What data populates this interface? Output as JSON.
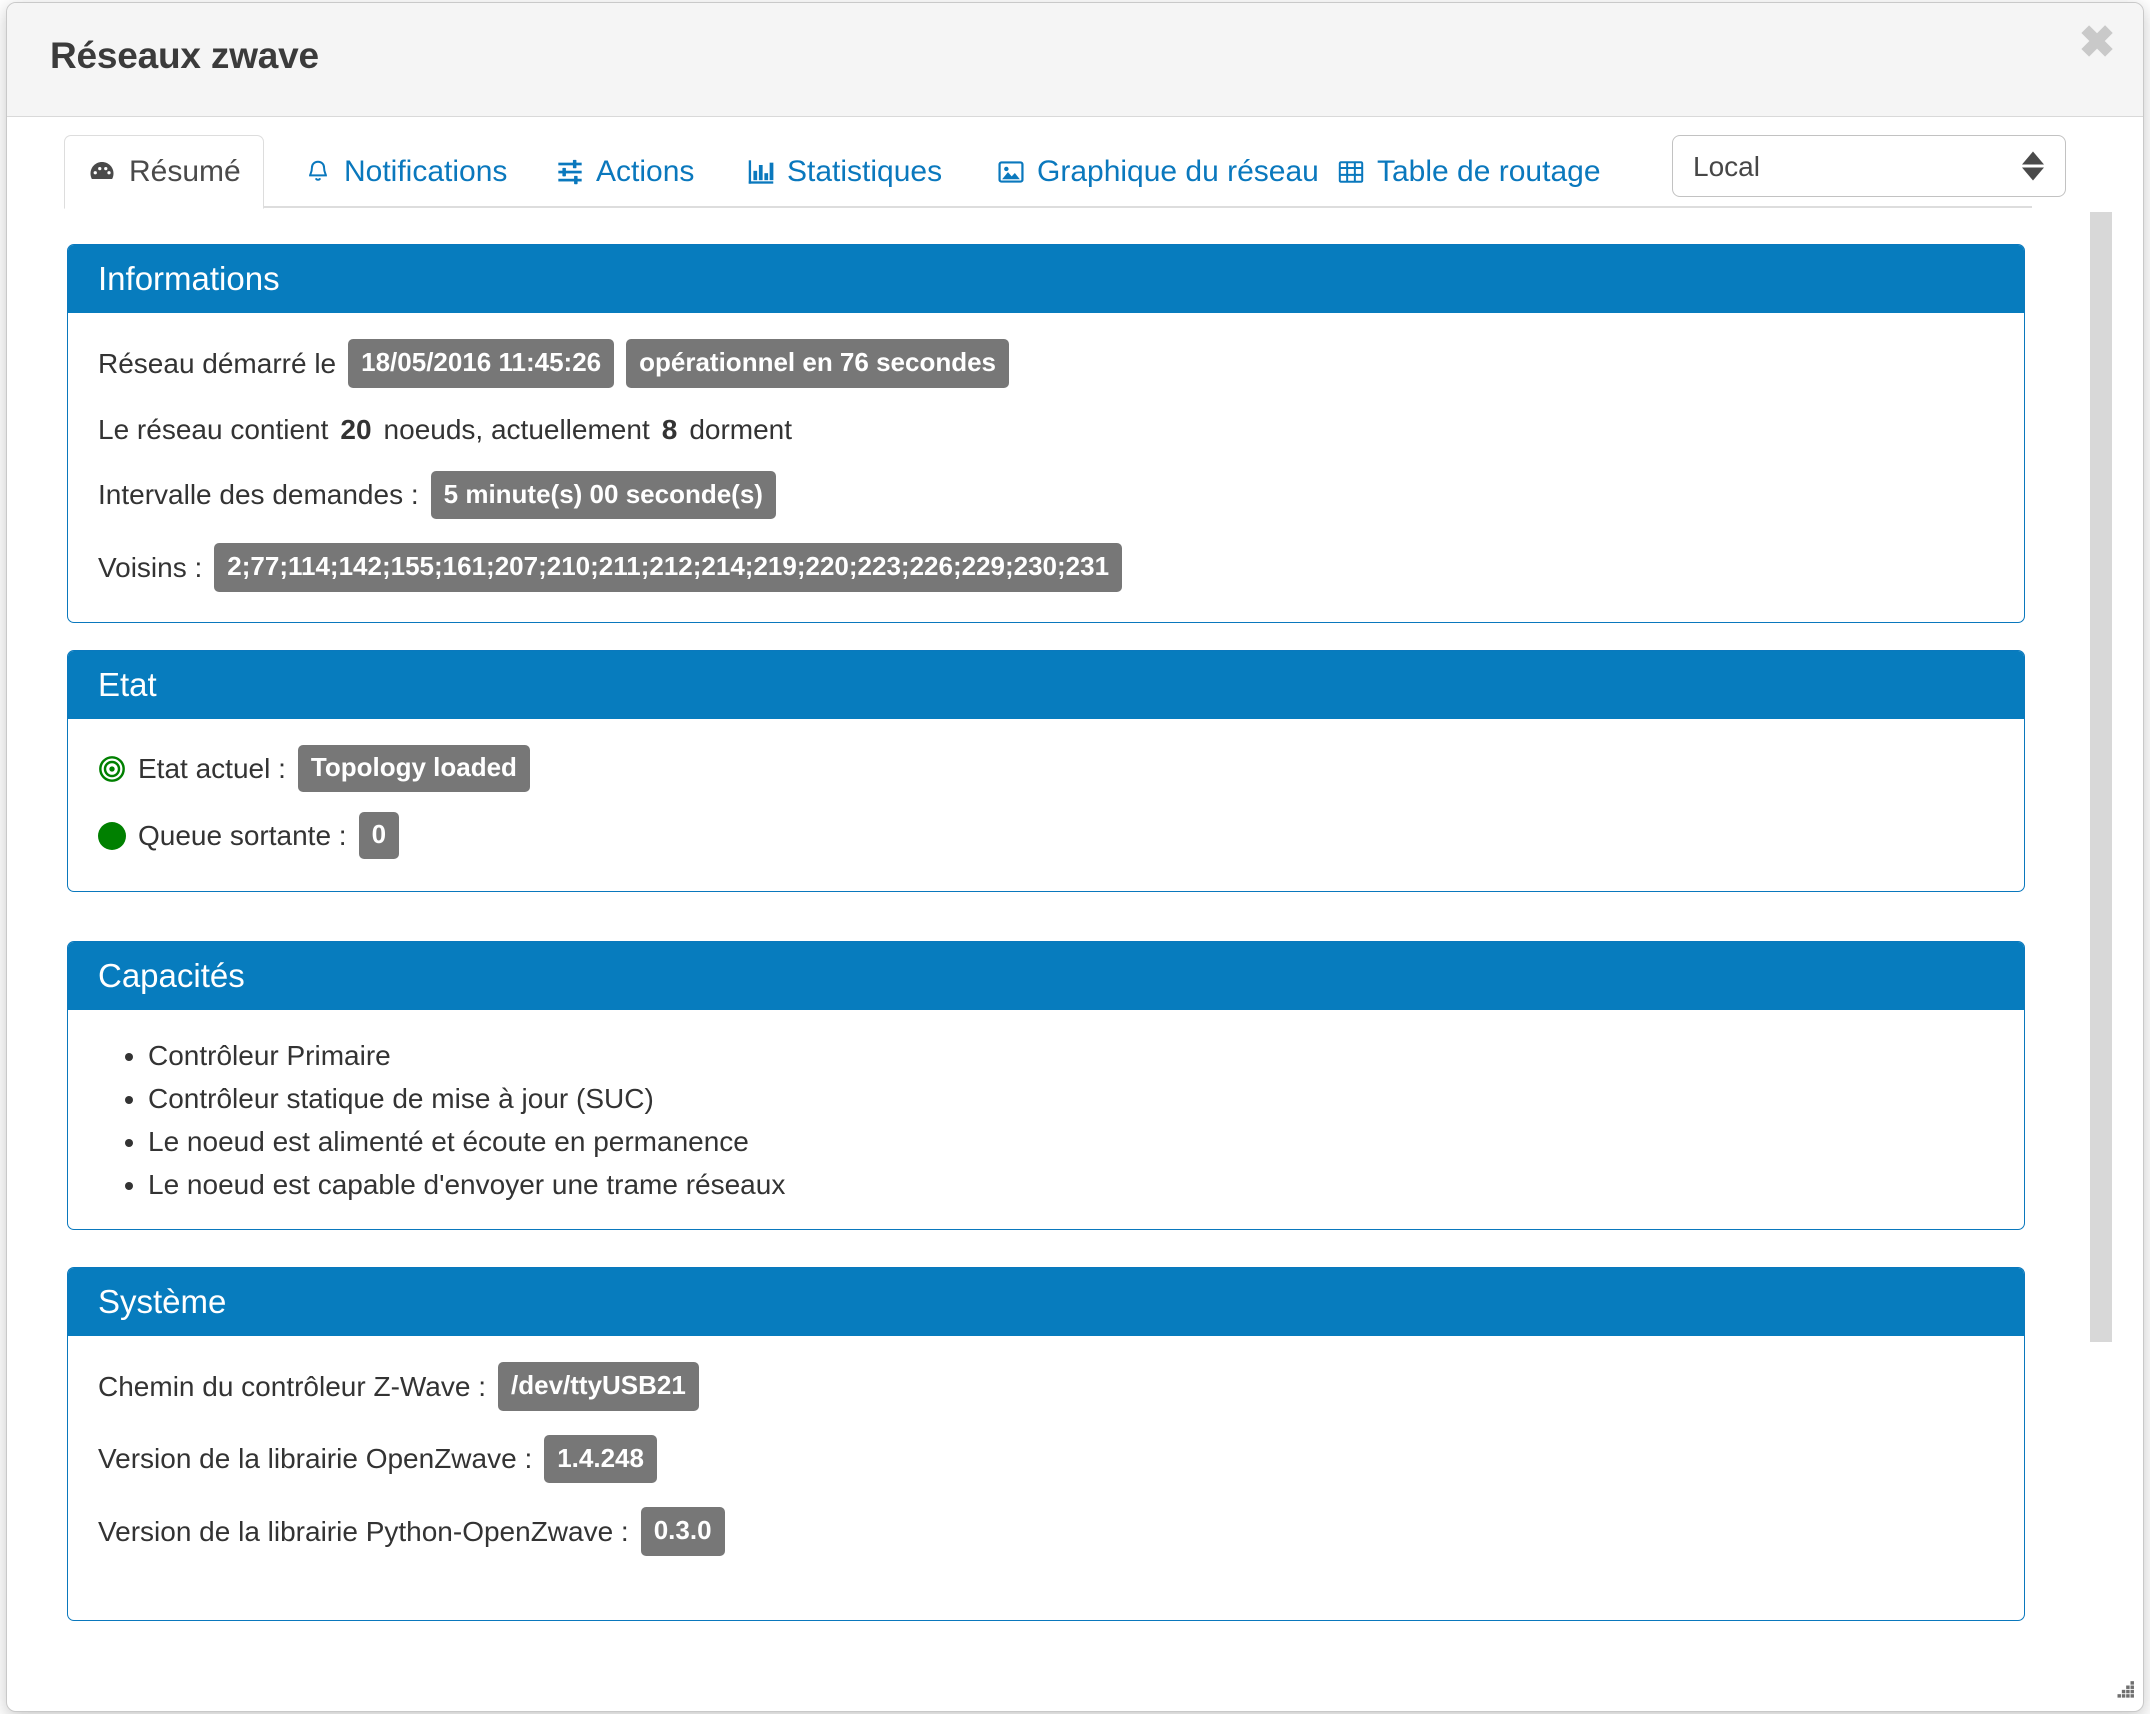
{
  "window": {
    "title": "Réseaux zwave",
    "close_label": "✖",
    "resize_handle": "resize-grip"
  },
  "tabs": [
    {
      "id": "resume",
      "label": "Résumé",
      "icon": "dashboard-icon",
      "active": true
    },
    {
      "id": "notifications",
      "label": "Notifications",
      "icon": "bell-icon",
      "active": false
    },
    {
      "id": "actions",
      "label": "Actions",
      "icon": "sliders-icon",
      "active": false
    },
    {
      "id": "statistiques",
      "label": "Statistiques",
      "icon": "bar-chart-icon",
      "active": false
    },
    {
      "id": "graphique",
      "label": "Graphique du réseau",
      "icon": "picture-icon",
      "active": false
    },
    {
      "id": "routage",
      "label": "Table de routage",
      "icon": "table-icon",
      "active": false
    }
  ],
  "network_select": {
    "value": "Local",
    "options": [
      "Local"
    ]
  },
  "panels": {
    "informations": {
      "title": "Informations",
      "started_label": "Réseau démarré le",
      "started_at": "18/05/2016 11:45:26",
      "operational_badge": "opérationnel en 76 secondes",
      "nodes_prefix": "Le réseau contient",
      "nodes_count": "20",
      "nodes_middle": "noeuds, actuellement",
      "sleeping_count": "8",
      "nodes_suffix": "dorment",
      "interval_label": "Intervalle des demandes :",
      "interval_value": "5 minute(s) 00 seconde(s)",
      "neighbours_label": "Voisins :",
      "neighbours_value": "2;77;114;142;155;161;207;210;211;212;214;219;220;223;226;229;230;231"
    },
    "etat": {
      "title": "Etat",
      "current_label": "Etat actuel :",
      "current_value": "Topology loaded",
      "current_icon": "bullseye-icon",
      "current_color": "#008000",
      "queue_label": "Queue sortante :",
      "queue_value": "0",
      "queue_icon": "circle-icon",
      "queue_color": "#008000"
    },
    "capacites": {
      "title": "Capacités",
      "items": [
        "Contrôleur Primaire",
        "Contrôleur statique de mise à jour (SUC)",
        "Le noeud est alimenté et écoute en permanence",
        "Le noeud est capable d'envoyer une trame réseaux"
      ]
    },
    "systeme": {
      "title": "Système",
      "controller_path_label": "Chemin du contrôleur Z-Wave :",
      "controller_path_value": "/dev/ttyUSB21",
      "openzwave_label": "Version de la librairie OpenZwave :",
      "openzwave_value": "1.4.248",
      "python_openzwave_label": "Version de la librairie Python-OpenZwave :",
      "python_openzwave_value": "0.3.0"
    }
  },
  "colors": {
    "panel_header": "#077cbe",
    "panel_border": "#0a78bd",
    "tab_link": "#0a78bd",
    "badge": "#777777",
    "status_green": "#008000",
    "titlebar": "#f5f5f5"
  }
}
